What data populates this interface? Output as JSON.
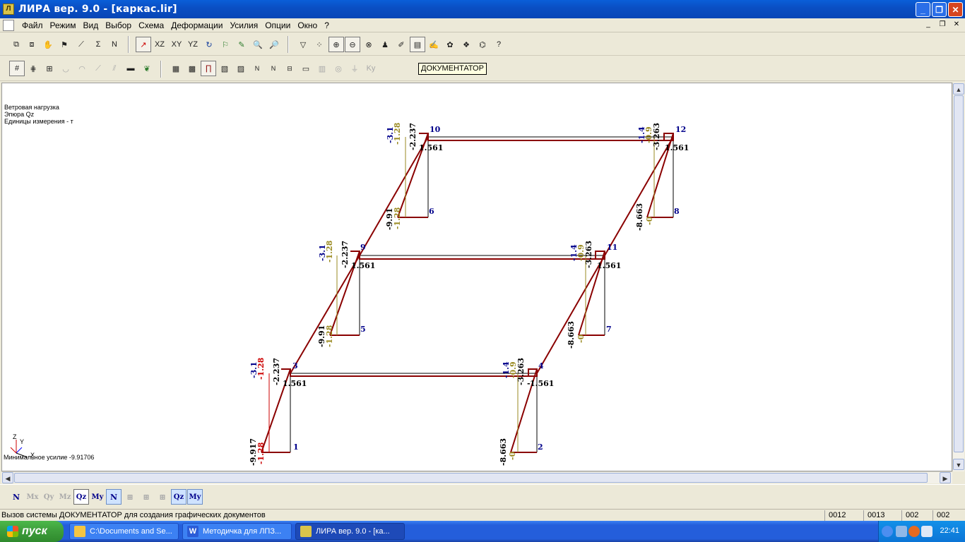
{
  "window": {
    "title": "ЛИРА  вер. 9.0 - [каркас.lir]",
    "app_icon": "lira-app-icon"
  },
  "menu": [
    "Файл",
    "Режим",
    "Вид",
    "Выбор",
    "Схема",
    "Деформации",
    "Усилия",
    "Опции",
    "Окно",
    "?"
  ],
  "tooltip": "ДОКУМЕНТАТОР",
  "canvas_info": {
    "load": "Ветровая нагрузка",
    "diagram": "Эпюра Qz",
    "units": "Единицы измерения - т",
    "min_force": "Минимальное усилие  -9.91706"
  },
  "axes": {
    "z": "Z",
    "y": "Y",
    "x": "X"
  },
  "frame": {
    "node_labels": [
      "1",
      "2",
      "3",
      "4",
      "5",
      "6",
      "7",
      "8",
      "9",
      "10",
      "11",
      "12"
    ],
    "value_labels": {
      "beam": "1.561",
      "left_neg": "-2.237",
      "left_top1": "-3.1",
      "left_top2": "-1.28",
      "left_bot": "-9.917",
      "left_bot_short": "-9.91",
      "right_top1": "-1.4",
      "right_top2": "-0.9",
      "right_neg": "-3.263",
      "right_bot": "-8.663",
      "right_bot2": "-0"
    }
  },
  "force_buttons": [
    "N",
    "Mx",
    "Qy",
    "Mz",
    "Qz",
    "My",
    "N",
    "",
    "",
    "",
    "Qz",
    "My"
  ],
  "status": {
    "text": "Вызов системы ДОКУМЕНТАТОР для создания графических документов",
    "cells": [
      "0012",
      "0013",
      "002",
      "002"
    ]
  },
  "taskbar": {
    "start": "пуск",
    "items": [
      "C:\\Documents and Se...",
      "Методичка для ЛПЗ...",
      "ЛИРА  вер. 9.0 - [ка..."
    ],
    "clock": "22:41"
  }
}
